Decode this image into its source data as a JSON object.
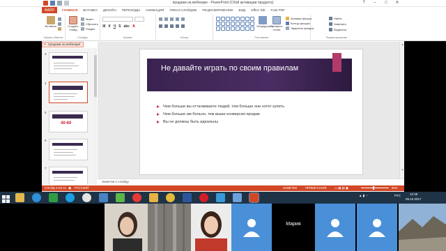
{
  "window": {
    "title": "продажи на вебинаре - PowerPoint (Сбой активации продукта)",
    "controls": [
      "?",
      "–",
      "□",
      "✕"
    ]
  },
  "ribbon": {
    "file_tab": "ФАЙЛ",
    "tabs": [
      "ГЛАВНАЯ",
      "ВСТАВКА",
      "ДИЗАЙН",
      "ПЕРЕХОДЫ",
      "АНИМАЦИЯ",
      "ПОКАЗ СЛАЙДОВ",
      "РЕЦЕНЗИРОВАНИЕ",
      "ВИД",
      "Office Tab",
      "Foxit PDF"
    ],
    "active_tab": "ГЛАВНАЯ",
    "groups": {
      "clipboard": {
        "label": "Буфер обмена",
        "paste": "Вставить"
      },
      "slides": {
        "label": "Слайды",
        "new_slide": "Создать слайд",
        "layout": "Макет",
        "reset": "Сбросить",
        "section": "Раздел"
      },
      "font": {
        "label": "Шрифт"
      },
      "paragraph": {
        "label": "Абзац"
      },
      "drawing": {
        "label": "Рисование",
        "arrange": "Упорядочить",
        "quick_styles": "Экспресс-стили",
        "fill": "Заливка фигуры",
        "outline": "Контур фигуры",
        "effects": "Эффекты фигуры"
      },
      "editing": {
        "label": "Редактирование",
        "find": "Найти",
        "replace": "Заменить",
        "select": "Выделить"
      }
    }
  },
  "panel": {
    "tab_label": "продажи на вебинаре",
    "slides": [
      {
        "num": "3",
        "selected": false,
        "big": ""
      },
      {
        "num": "4",
        "selected": true,
        "big": ""
      },
      {
        "num": "5",
        "selected": false,
        "big": "40-60"
      },
      {
        "num": "6",
        "selected": false,
        "big": ""
      },
      {
        "num": "7",
        "selected": false,
        "big": ""
      }
    ]
  },
  "slide": {
    "title": "Не давайте играть по своим правилам",
    "bullets": [
      "Чем больше вы отталкиваете людей, тем больше они хотят купить",
      "Чем больше им больно, тем выше конверсия продаж",
      "Вы не должны быть идеальны"
    ],
    "accent_color": "#b23a6a",
    "band_color": "#3a2350"
  },
  "notes": {
    "placeholder": "Заметки к слайду"
  },
  "statusbar": {
    "slide_info": "СЛАЙД 4 ИЗ 21",
    "language": "РУССКИЙ",
    "notes_btn": "ЗАМЕТКИ",
    "comments_btn": "ПРИМЕЧАНИЯ",
    "zoom": "66%"
  },
  "taskbar": {
    "lang": "РУС",
    "time": "12:49",
    "date": "09.10.2017"
  },
  "video": {
    "participant_name": "Мария"
  },
  "colors": {
    "accent": "#d24726",
    "taskbar": "#1f3346",
    "avatar_bg": "#4a90d9"
  }
}
